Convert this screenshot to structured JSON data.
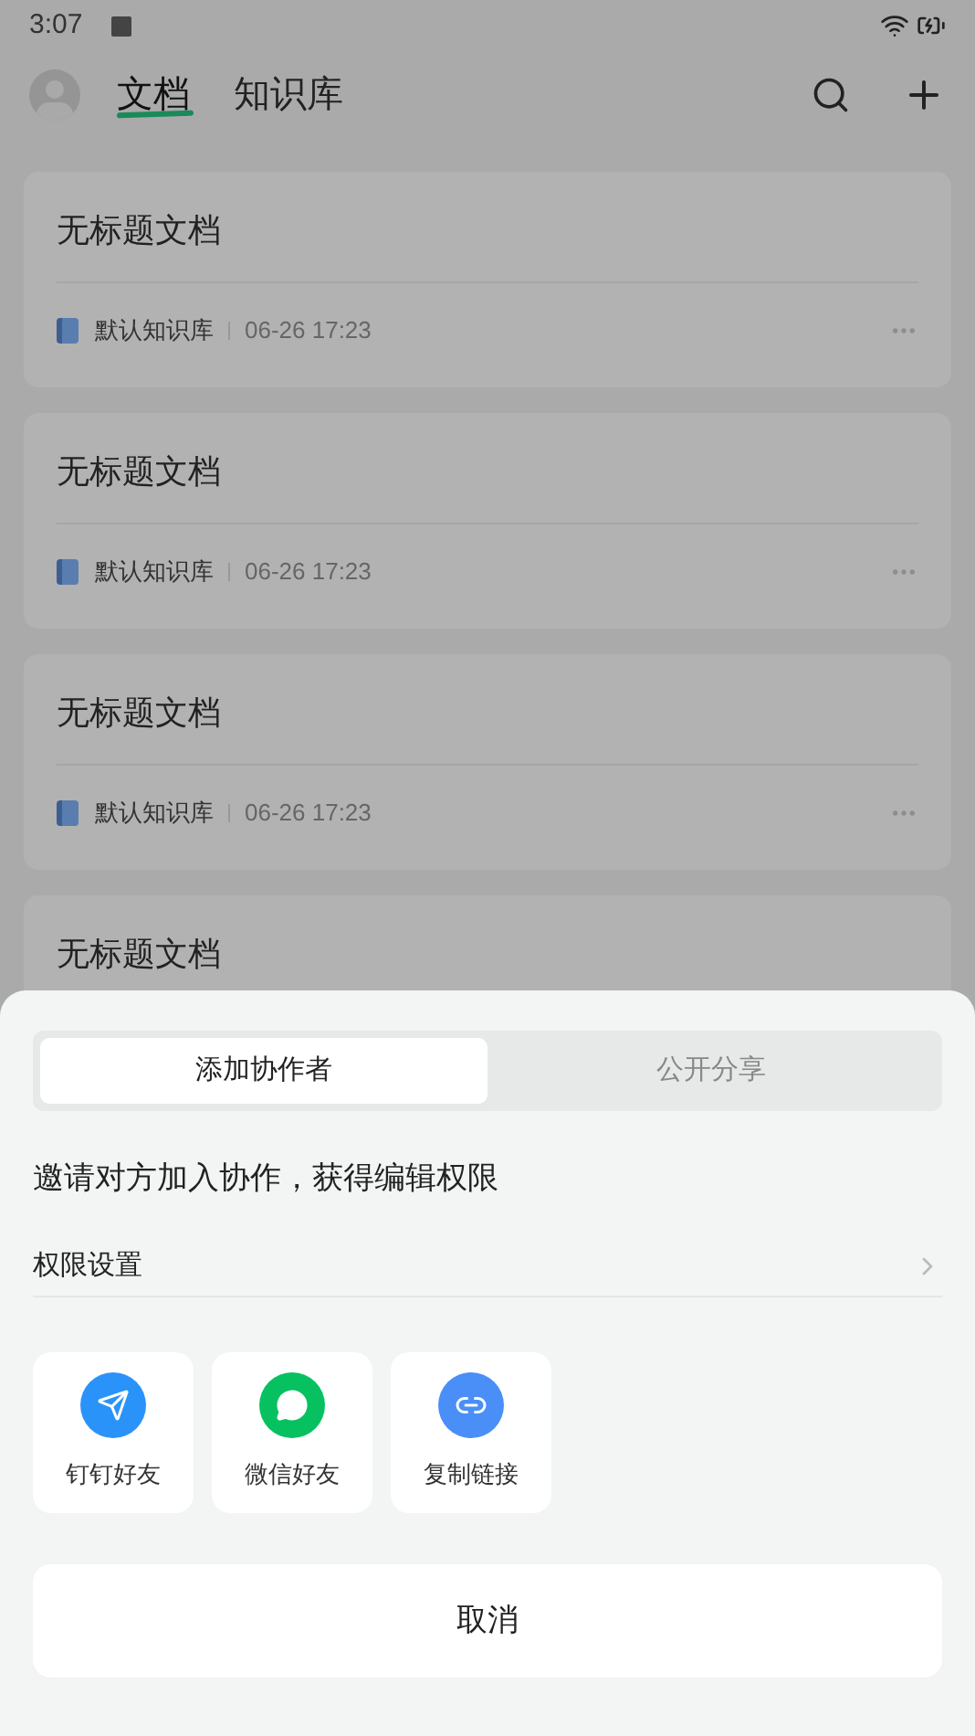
{
  "status_bar": {
    "time": "3:07"
  },
  "header": {
    "tabs": [
      {
        "label": "文档",
        "selected": true
      },
      {
        "label": "知识库",
        "selected": false
      }
    ]
  },
  "documents": [
    {
      "title": "无标题文档",
      "library": "默认知识库",
      "time": "06-26 17:23"
    },
    {
      "title": "无标题文档",
      "library": "默认知识库",
      "time": "06-26 17:23"
    },
    {
      "title": "无标题文档",
      "library": "默认知识库",
      "time": "06-26 17:23"
    },
    {
      "title": "无标题文档"
    }
  ],
  "share_sheet": {
    "tabs": [
      {
        "label": "添加协作者",
        "selected": true
      },
      {
        "label": "公开分享",
        "selected": false
      }
    ],
    "description": "邀请对方加入协作，获得编辑权限",
    "permission_row": "权限设置",
    "targets": [
      {
        "kind": "dingtalk",
        "label": "钉钉好友"
      },
      {
        "kind": "wechat",
        "label": "微信好友"
      },
      {
        "kind": "link",
        "label": "复制链接"
      }
    ],
    "cancel": "取消"
  }
}
